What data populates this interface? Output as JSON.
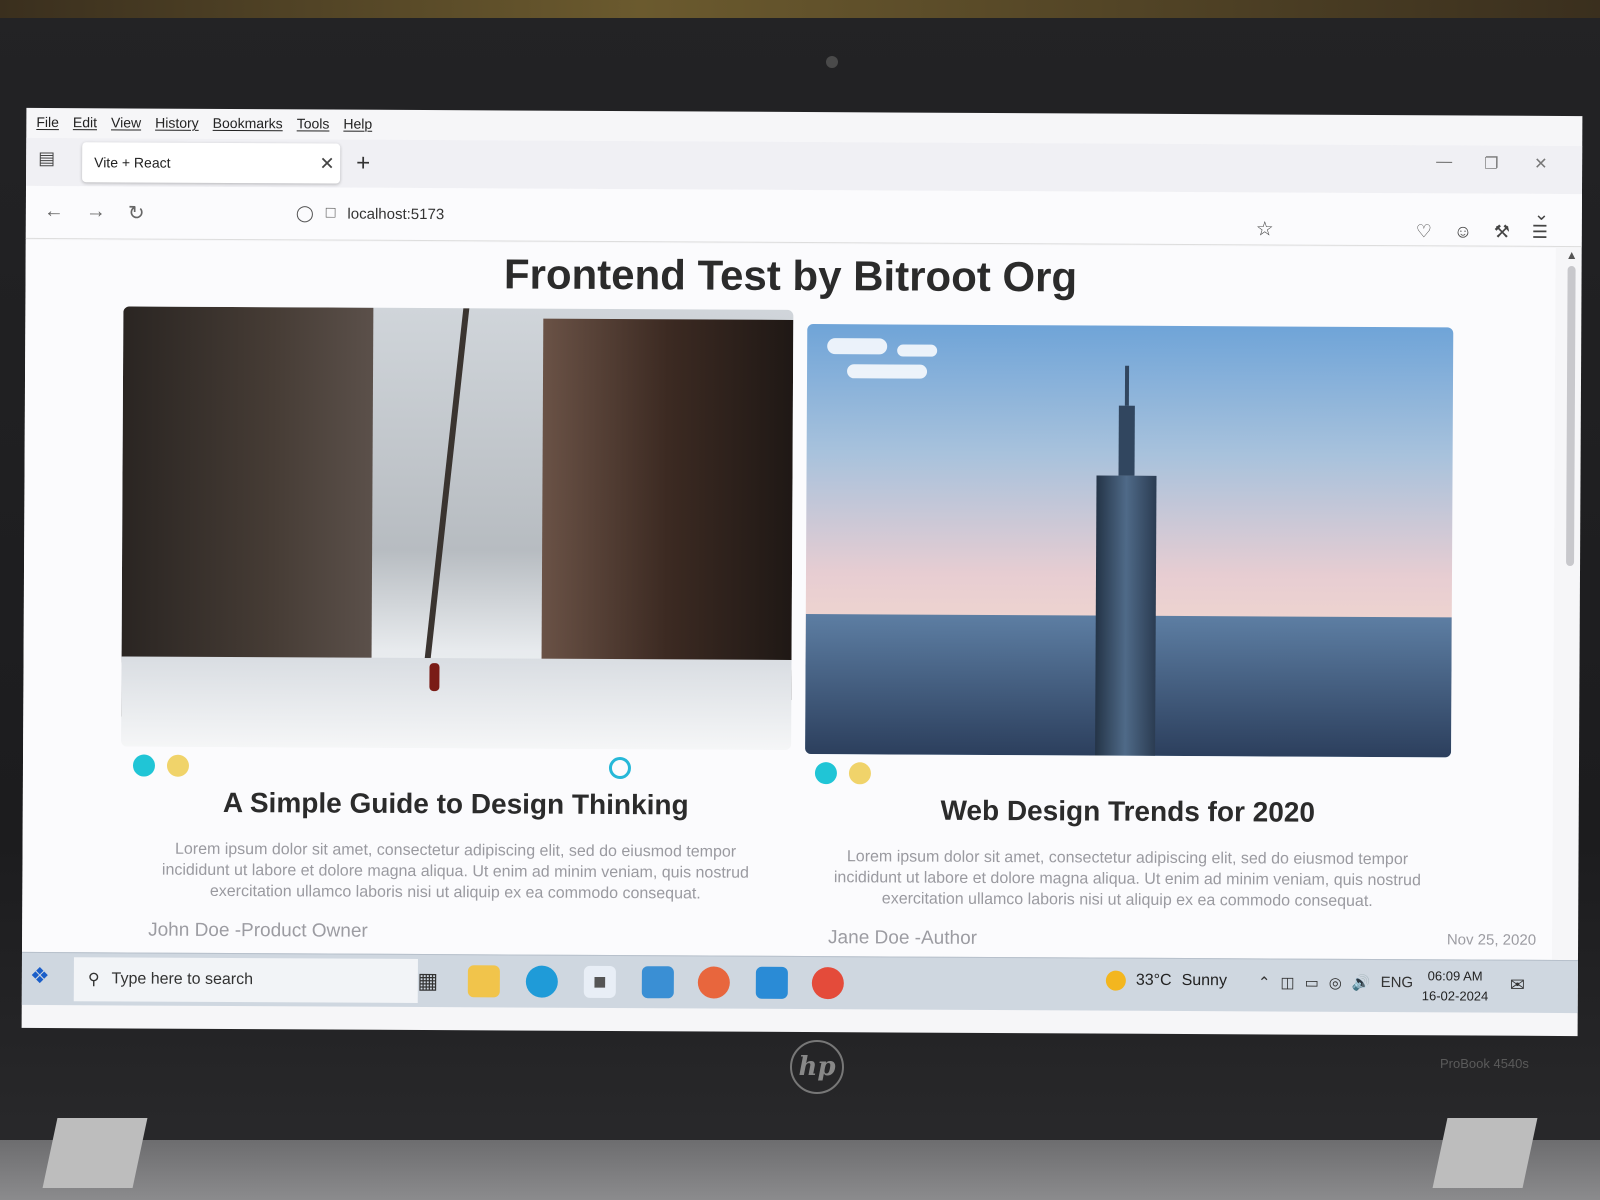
{
  "menubar": [
    "File",
    "Edit",
    "View",
    "History",
    "Bookmarks",
    "Tools",
    "Help"
  ],
  "tab": {
    "title": "Vite + React"
  },
  "address_bar": {
    "url": "localhost:5173"
  },
  "page": {
    "title": "Frontend Test by Bitroot Org",
    "cards": [
      {
        "title": "A Simple Guide to Design Thinking",
        "body": "Lorem ipsum dolor sit amet, consectetur adipiscing elit, sed do eiusmod tempor incididunt ut labore et dolore magna aliqua. Ut enim ad minim veniam, quis nostrud exercitation ullamco laboris nisi ut aliquip ex ea commodo consequat.",
        "author": "John Doe -Product Owner",
        "date": ""
      },
      {
        "title": "Web Design Trends for 2020",
        "body": "Lorem ipsum dolor sit amet, consectetur adipiscing elit, sed do eiusmod tempor incididunt ut labore et dolore magna aliqua. Ut enim ad minim veniam, quis nostrud exercitation ullamco laboris nisi ut aliquip ex ea commodo consequat.",
        "author": "Jane Doe -Author",
        "date": "Nov 25, 2020"
      }
    ]
  },
  "taskbar": {
    "search_placeholder": "Type here to search",
    "weather": {
      "temp": "33°C",
      "condition": "Sunny"
    },
    "lang": "ENG",
    "time": "06:09 AM",
    "date": "16-02-2024"
  },
  "device": {
    "model": "ProBook 4540s",
    "logo": "hp"
  },
  "colors": {
    "dot_cyan": "#20c5d6",
    "dot_yellow": "#f0d36a",
    "taskbar": "#cfd7e0"
  }
}
